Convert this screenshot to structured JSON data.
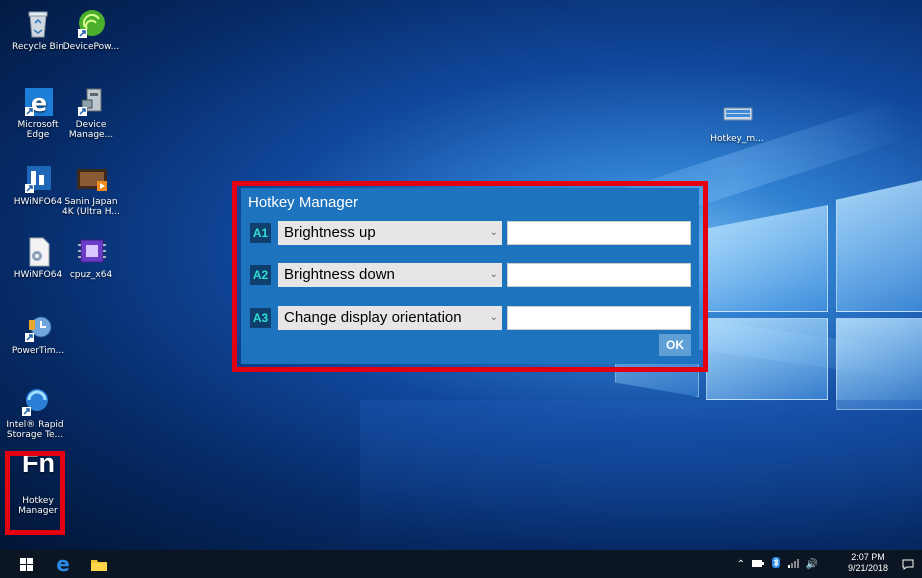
{
  "desktop": {
    "icons": [
      {
        "label": "Recycle Bin"
      },
      {
        "label": "DevicePow..."
      },
      {
        "label": "Microsoft Edge"
      },
      {
        "label": "Device Manage..."
      },
      {
        "label": "HWiNFO64"
      },
      {
        "label": "Sanin Japan 4K (Ultra H..."
      },
      {
        "label": "HWiNFO64"
      },
      {
        "label": "cpuz_x64"
      },
      {
        "label": "PowerTim..."
      },
      {
        "label": "Intel® Rapid Storage Te..."
      },
      {
        "label": "Hotkey Manager"
      },
      {
        "label": "Hotkey_m..."
      }
    ],
    "hotkey_glyph": "Fn"
  },
  "dialog": {
    "title": "Hotkey Manager",
    "rows": [
      {
        "badge": "A1",
        "selected": "Brightness up",
        "value": ""
      },
      {
        "badge": "A2",
        "selected": "Brightness down",
        "value": ""
      },
      {
        "badge": "A3",
        "selected": "Change display orientation",
        "value": ""
      }
    ],
    "ok_label": "OK"
  },
  "taskbar": {
    "time": "2:07 PM",
    "date": "9/21/2018"
  },
  "colors": {
    "dialog_bg": "#1d73be",
    "highlight": "#e40010",
    "badge_text": "#2fe0d0"
  }
}
